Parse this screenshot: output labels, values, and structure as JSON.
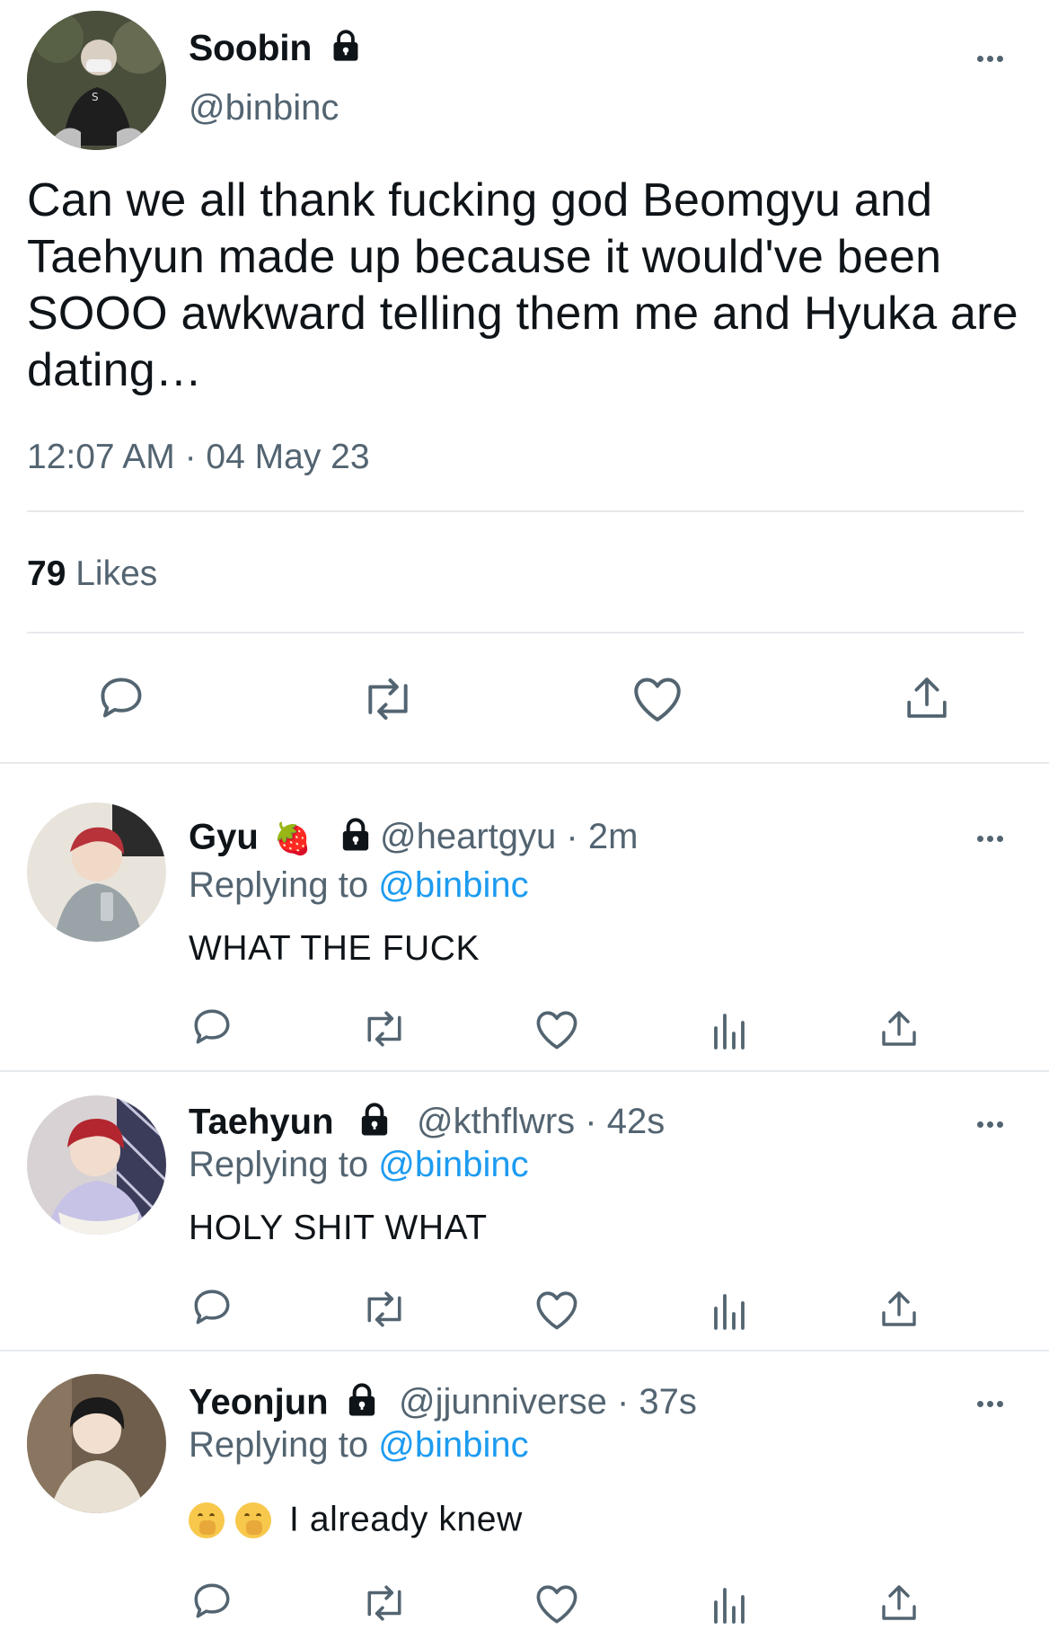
{
  "main_tweet": {
    "name": "Soobin",
    "handle": "@binbinc",
    "text": "Can we all thank fucking god Beomgyu and Taehyun made up because it would've been SOOO awkward telling them me and Hyuka are dating…",
    "timestamp": "12:07 AM · 04 May 23",
    "likes_count": "79",
    "likes_label": "Likes",
    "actions": [
      "reply-icon",
      "retweet-icon",
      "like-icon",
      "share-icon"
    ]
  },
  "replies": [
    {
      "name": "Gyu",
      "name_emoji": "🍓",
      "handle": "@heartgyu",
      "time": "· 2m",
      "replying_prefix": "Replying to",
      "replying_to": "@binbinc",
      "text": "WHAT THE FUCK"
    },
    {
      "name": "Taehyun",
      "handle": "@kthflwrs",
      "time": "· 42s",
      "replying_prefix": "Replying to",
      "replying_to": "@binbinc",
      "text": "HOLY SHIT WHAT"
    },
    {
      "name": "Yeonjun",
      "handle": "@jjunniverse",
      "time": "· 37s",
      "replying_prefix": "Replying to",
      "replying_to": "@binbinc",
      "text": "I already knew"
    }
  ],
  "colors": {
    "text": "#0f1419",
    "secondary": "#536471",
    "link": "#1d9bf0",
    "divider": "#e6e9ec"
  }
}
